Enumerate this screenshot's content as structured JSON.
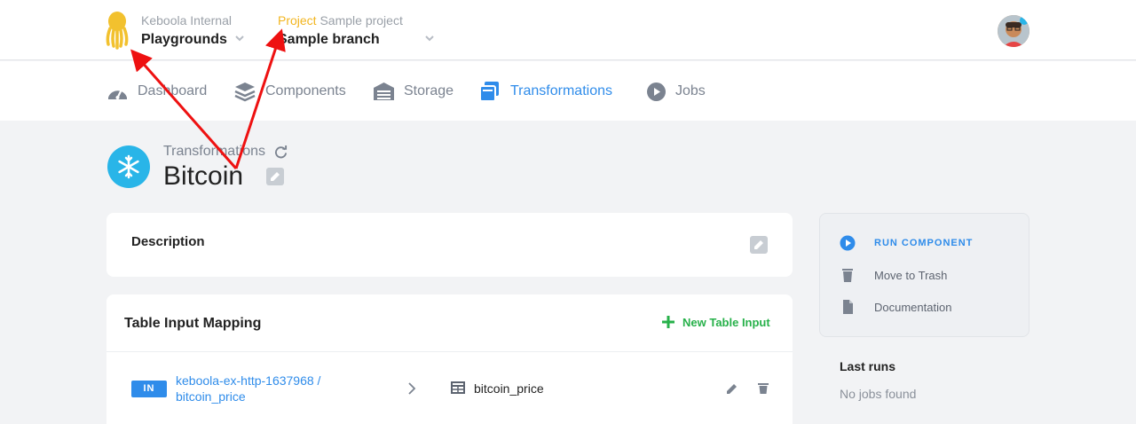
{
  "header": {
    "org_label": "Keboola Internal",
    "org_value": "Playgrounds",
    "project_prefix": "Project",
    "project_name": "Sample project",
    "branch_value": "Sample branch",
    "logo_color": "#f2c12e"
  },
  "nav": {
    "items": [
      {
        "label": "Dashboard",
        "icon": "dashboard-icon"
      },
      {
        "label": "Components",
        "icon": "layers-icon"
      },
      {
        "label": "Storage",
        "icon": "warehouse-icon"
      },
      {
        "label": "Transformations",
        "icon": "transformations-icon",
        "active": true
      },
      {
        "label": "Jobs",
        "icon": "play-circle-icon"
      }
    ],
    "active_color": "#2f8cea"
  },
  "page": {
    "breadcrumb": "Transformations",
    "title": "Bitcoin",
    "component_icon": "snowflake-icon"
  },
  "description": {
    "title": "Description"
  },
  "input_mapping": {
    "title": "Table Input Mapping",
    "new_button": "New Table Input",
    "rows": [
      {
        "badge": "IN",
        "source_line1": "keboola-ex-http-1637968 /",
        "source_line2": "bitcoin_price",
        "destination": "bitcoin_price"
      }
    ]
  },
  "sidebar": {
    "run_label": "RUN COMPONENT",
    "trash_label": "Move to Trash",
    "docs_label": "Documentation",
    "last_runs_title": "Last runs",
    "no_jobs": "No jobs found"
  },
  "colors": {
    "accent_blue": "#2f8cea",
    "accent_green": "#27b14a",
    "annotation_red": "#ee1111"
  }
}
